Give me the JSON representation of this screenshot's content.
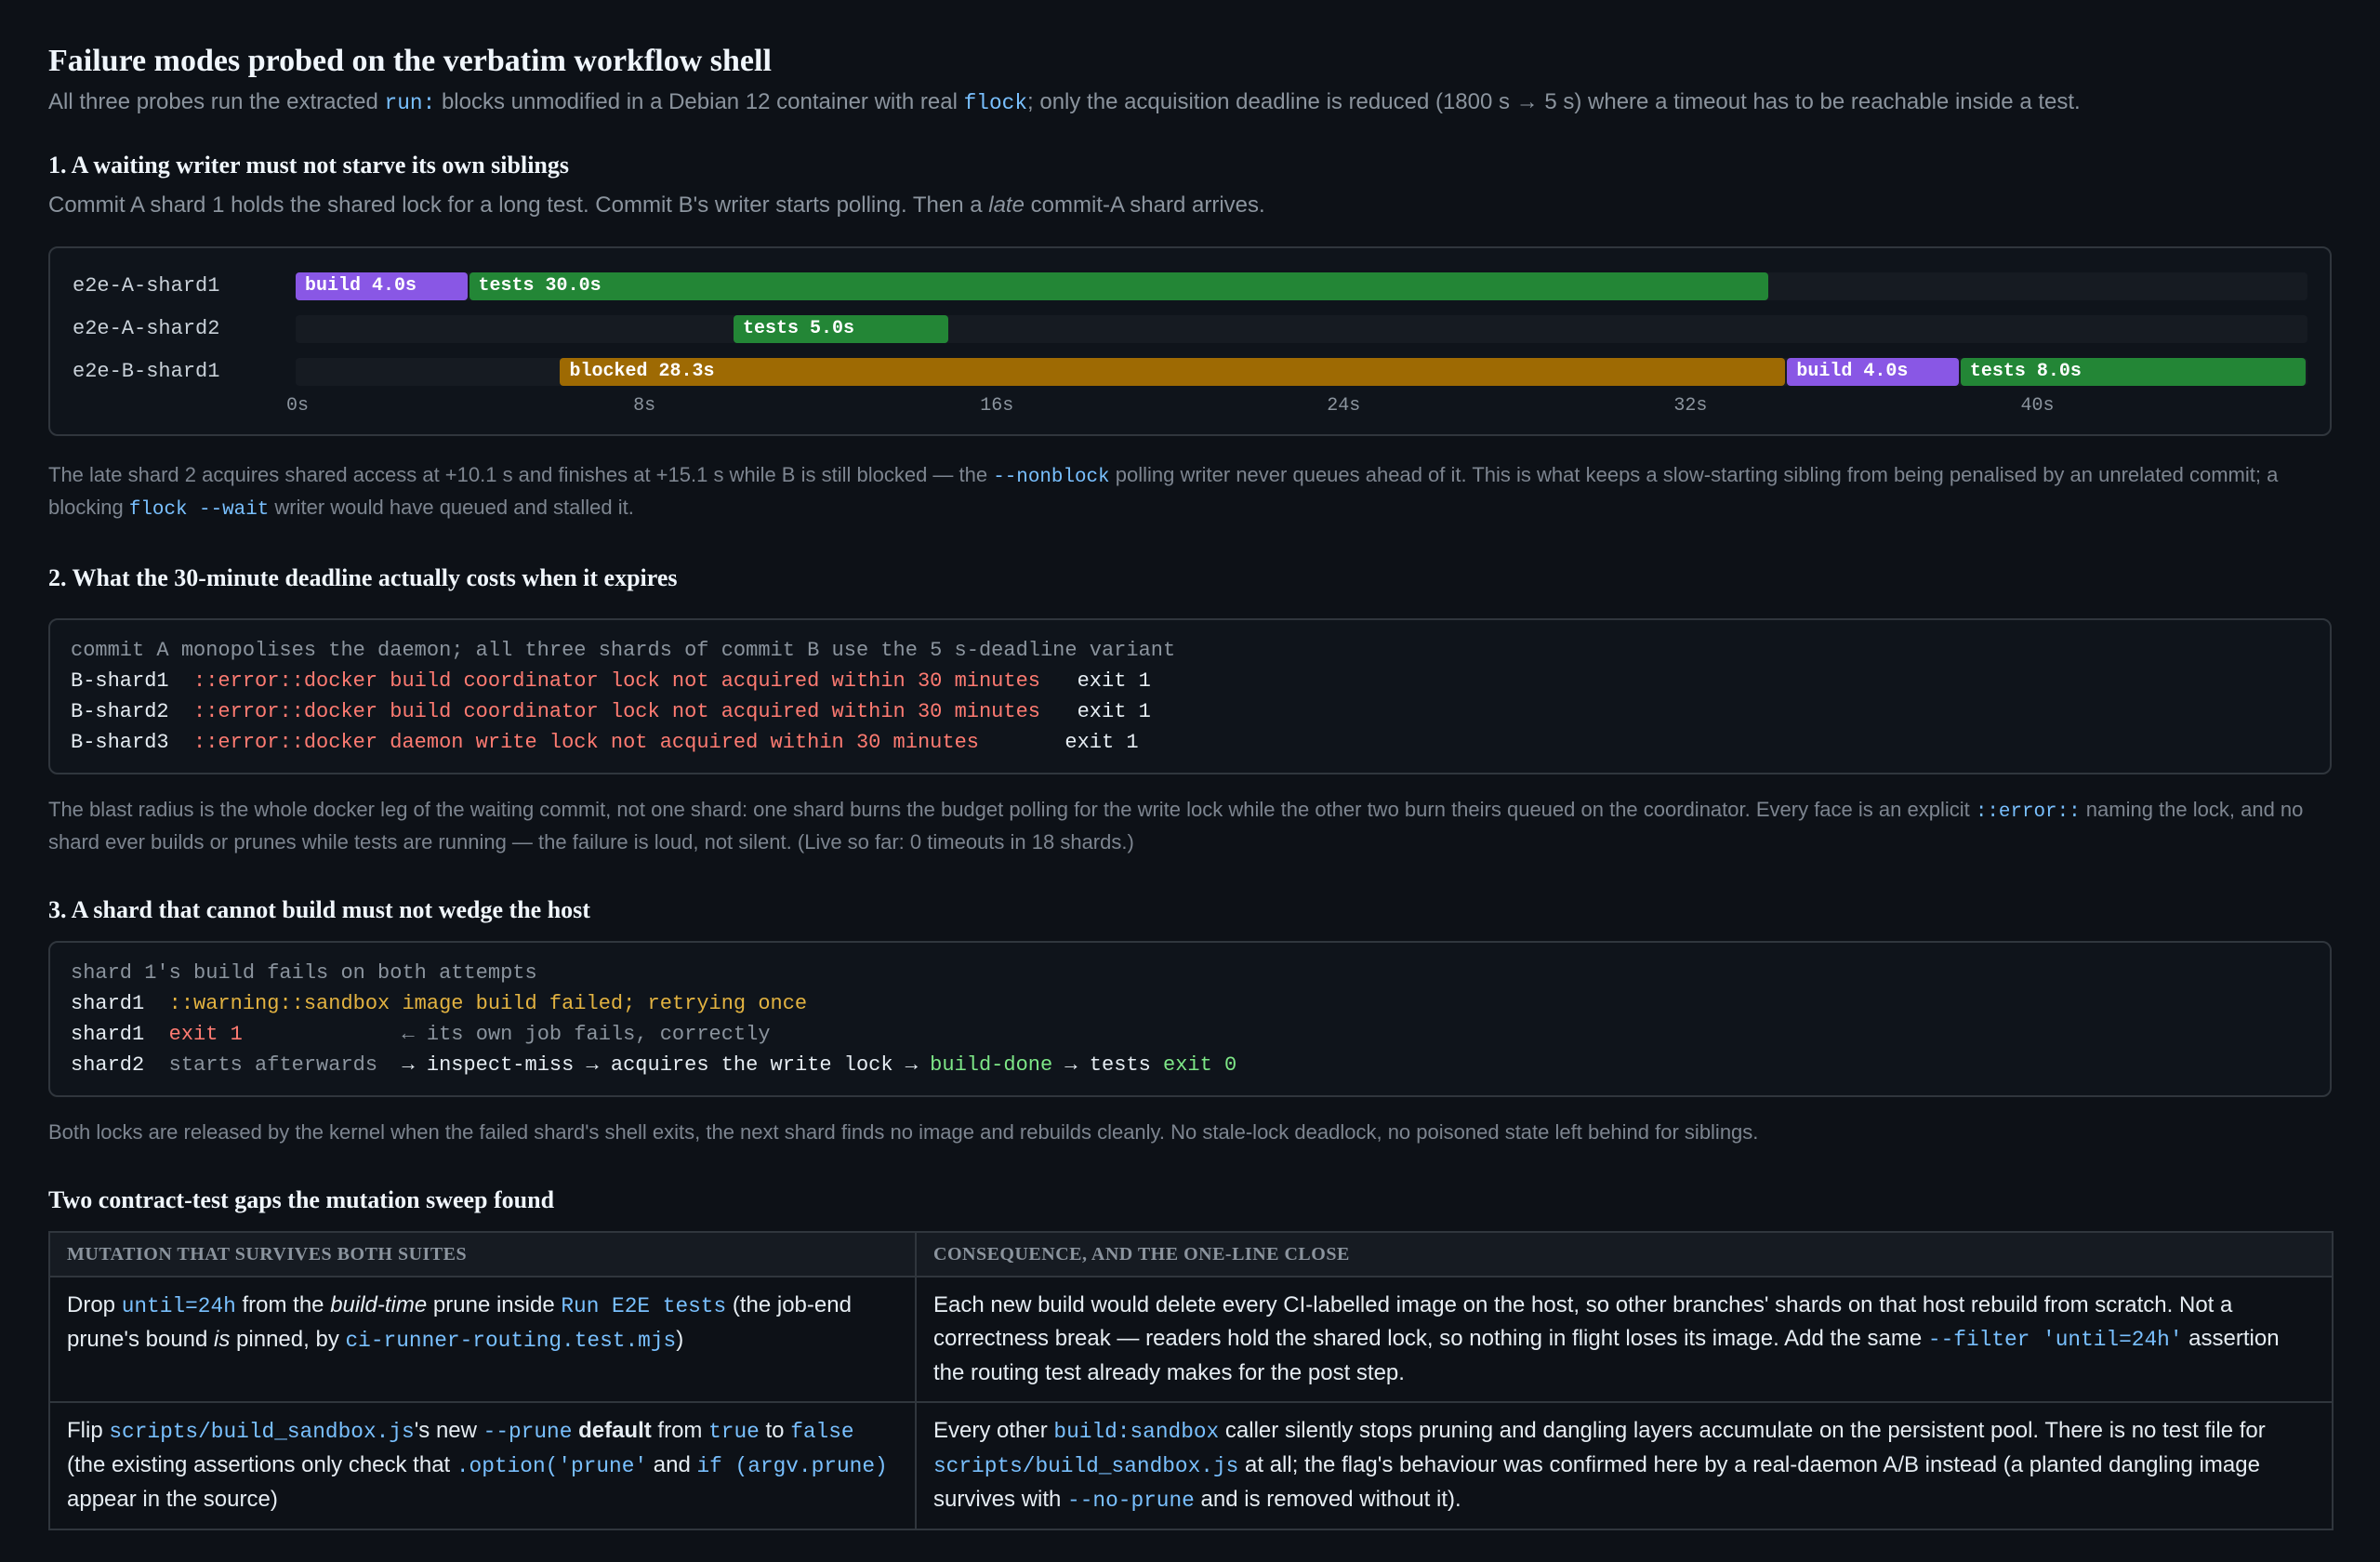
{
  "title": "Failure modes probed on the verbatim workflow shell",
  "lead": {
    "a": "All three probes run the extracted ",
    "code1": "run:",
    "b": " blocks unmodified in a Debian 12 container with real ",
    "code2": "flock",
    "c": "; only the acquisition deadline is reduced (1800 s → 5 s) where a timeout has to be reachable inside a test."
  },
  "section1": {
    "heading": "1. A waiting writer must not starve its own siblings",
    "intro_a": "Commit A shard 1 holds the shared lock for a long test. Commit B's writer starts polling. Then a ",
    "intro_em": "late",
    "intro_b": " commit-A shard arrives.",
    "note": {
      "a": "The late shard 2 acquires shared access at +10.1 s and finishes at +15.1 s while B is still blocked — the ",
      "code1": "--nonblock",
      "b": " polling writer never queues ahead of it. This is what keeps a slow-starting sibling from being penalised by an unrelated commit; a blocking ",
      "code2": "flock --wait",
      "c": " writer would have queued and stalled it."
    }
  },
  "chart_data": {
    "type": "timeline",
    "x_unit": "s",
    "xlim": [
      0,
      46.4
    ],
    "ticks": [
      "0s",
      "8s",
      "16s",
      "24s",
      "32s",
      "40s"
    ],
    "tick_values": [
      0,
      8,
      16,
      24,
      32,
      40
    ],
    "lanes": [
      {
        "name": "e2e-A-shard1",
        "segments": [
          {
            "kind": "build",
            "label": "build 4.0s",
            "start": 0,
            "end": 4.0
          },
          {
            "kind": "tests",
            "label": "tests 30.0s",
            "start": 4.0,
            "end": 34.0
          }
        ]
      },
      {
        "name": "e2e-A-shard2",
        "segments": [
          {
            "kind": "tests",
            "label": "tests 5.0s",
            "start": 10.1,
            "end": 15.1
          }
        ]
      },
      {
        "name": "e2e-B-shard1",
        "segments": [
          {
            "kind": "blocked",
            "label": "blocked 28.3s",
            "start": 6.1,
            "end": 34.4
          },
          {
            "kind": "build",
            "label": "build 4.0s",
            "start": 34.4,
            "end": 38.4
          },
          {
            "kind": "tests",
            "label": "tests 8.0s",
            "start": 38.4,
            "end": 46.4
          }
        ]
      }
    ]
  },
  "section2": {
    "heading": "2. What the 30-minute deadline actually costs when it expires",
    "log_comment": "commit A monopolises the daemon; all three shards of commit B use the 5 s-deadline variant",
    "rows": [
      {
        "shard": "B-shard1",
        "msg": "::error::docker build coordinator lock not acquired within 30 minutes",
        "exit": "exit 1"
      },
      {
        "shard": "B-shard2",
        "msg": "::error::docker build coordinator lock not acquired within 30 minutes",
        "exit": "exit 1"
      },
      {
        "shard": "B-shard3",
        "msg": "::error::docker daemon write lock not acquired within 30 minutes",
        "exit": "exit 1"
      }
    ],
    "note": {
      "a": "The blast radius is the whole docker leg of the waiting commit, not one shard: one shard burns the budget polling for the write lock while the other two burn theirs queued on the coordinator. Every face is an explicit ",
      "code1": "::error::",
      "b": " naming the lock, and no shard ever builds or prunes while tests are running — the failure is loud, not silent. (Live so far: 0 timeouts in 18 shards.)"
    }
  },
  "section3": {
    "heading": "3. A shard that cannot build must not wedge the host",
    "log_comment": "shard 1's build fails on both attempts",
    "line1": {
      "shard": "shard1",
      "warn": "::warning::sandbox image build failed; retrying once"
    },
    "line2": {
      "shard": "shard1",
      "exit": "exit 1",
      "note": "← its own job fails, correctly"
    },
    "line3": {
      "shard": "shard2",
      "dim": "starts afterwards",
      "a": "→ inspect-miss → acquires the write lock →",
      "ok1": "build-done",
      "b": "→ tests",
      "ok2": "exit 0"
    },
    "note": "Both locks are released by the kernel when the failed shard's shell exits, the next shard finds no image and rebuilds cleanly. No stale-lock deadlock, no poisoned state left behind for siblings."
  },
  "section4": {
    "heading": "Two contract-test gaps the mutation sweep found",
    "col1": "MUTATION THAT SURVIVES BOTH SUITES",
    "col2": "CONSEQUENCE, AND THE ONE-LINE CLOSE",
    "r1c1": {
      "a": "Drop ",
      "code1": "until=24h",
      "b": " from the ",
      "em1": "build-time",
      "c": " prune inside ",
      "code2": "Run E2E tests",
      "d": " (the job-end prune's bound ",
      "em2": "is",
      "e": " pinned, by ",
      "code3": "ci-runner-routing.test.mjs",
      "f": ")"
    },
    "r1c2": {
      "a": "Each new build would delete every CI-labelled image on the host, so other branches' shards on that host rebuild from scratch. Not a correctness break — readers hold the shared lock, so nothing in flight loses its image. Add the same ",
      "code1": "--filter 'until=24h'",
      "b": " assertion the routing test already makes for the post step."
    },
    "r2c1": {
      "a": "Flip ",
      "code1": "scripts/build_sandbox.js",
      "b": "'s new ",
      "code2": "--prune",
      "strong": "default",
      "c": " from ",
      "code3": "true",
      "d": " to ",
      "code4": "false",
      "e": " (the existing assertions only check that ",
      "code5": ".option('prune'",
      "f": " and ",
      "code6": "if (argv.prune)",
      "g": " appear in the source)"
    },
    "r2c2": {
      "a": "Every other ",
      "code1": "build:sandbox",
      "b": " caller silently stops pruning and dangling layers accumulate on the persistent pool. There is no test file for ",
      "code2": "scripts/build_sandbox.js",
      "c": " at all; the flag's behaviour was confirmed here by a real-daemon A/B instead (a planted dangling image survives with ",
      "code3": "--no-prune",
      "d": " and is removed without it)."
    }
  }
}
